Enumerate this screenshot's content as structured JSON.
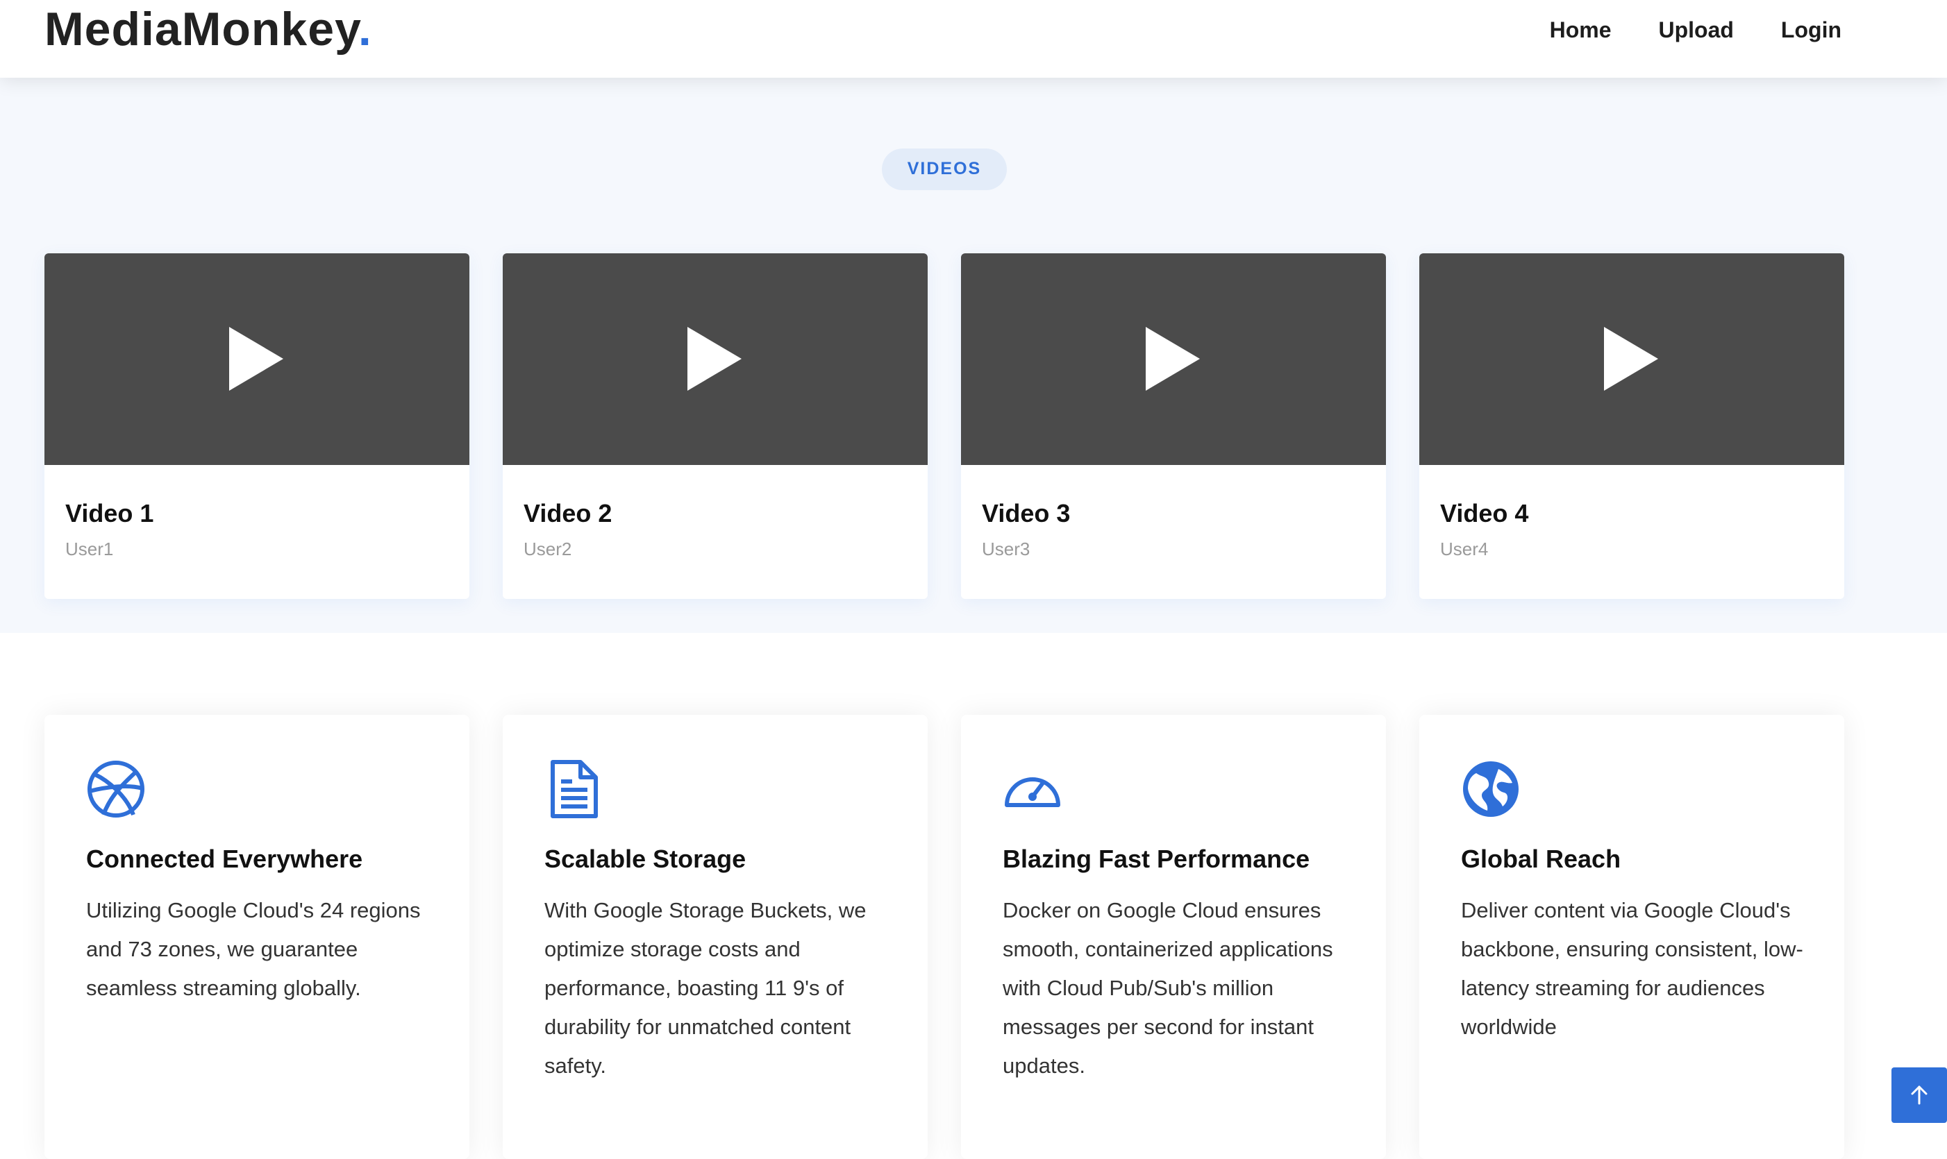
{
  "header": {
    "logo_text": "MediaMonkey",
    "logo_dot": ".",
    "nav": [
      {
        "label": "Home"
      },
      {
        "label": "Upload"
      },
      {
        "label": "Login"
      }
    ]
  },
  "videos_section": {
    "badge": "VIDEOS",
    "videos": [
      {
        "title": "Video 1",
        "user": "User1"
      },
      {
        "title": "Video 2",
        "user": "User2"
      },
      {
        "title": "Video 3",
        "user": "User3"
      },
      {
        "title": "Video 4",
        "user": "User4"
      }
    ]
  },
  "features": [
    {
      "icon": "dribbble-icon",
      "title": "Connected Everywhere",
      "description": "Utilizing Google Cloud's 24 regions and 73 zones, we guarantee seamless streaming globally."
    },
    {
      "icon": "file-text-icon",
      "title": "Scalable Storage",
      "description": "With Google Storage Buckets, we optimize storage costs and performance, boasting 11 9's of durability for unmatched content safety."
    },
    {
      "icon": "speedometer-icon",
      "title": "Blazing Fast Performance",
      "description": "Docker on Google Cloud ensures smooth, containerized applications with Cloud Pub/Sub's million messages per second for instant updates."
    },
    {
      "icon": "globe-icon",
      "title": "Global Reach",
      "description": "Deliver content via Google Cloud's backbone, ensuring consistent, low-latency streaming for audiences worldwide"
    }
  ],
  "back_to_top_icon": "arrow-up-icon",
  "colors": {
    "accent": "#2f6fd8",
    "thumbnail": "#4b4b4b",
    "section_bg": "#f5f8fd",
    "badge_bg": "#e3ecf9"
  }
}
